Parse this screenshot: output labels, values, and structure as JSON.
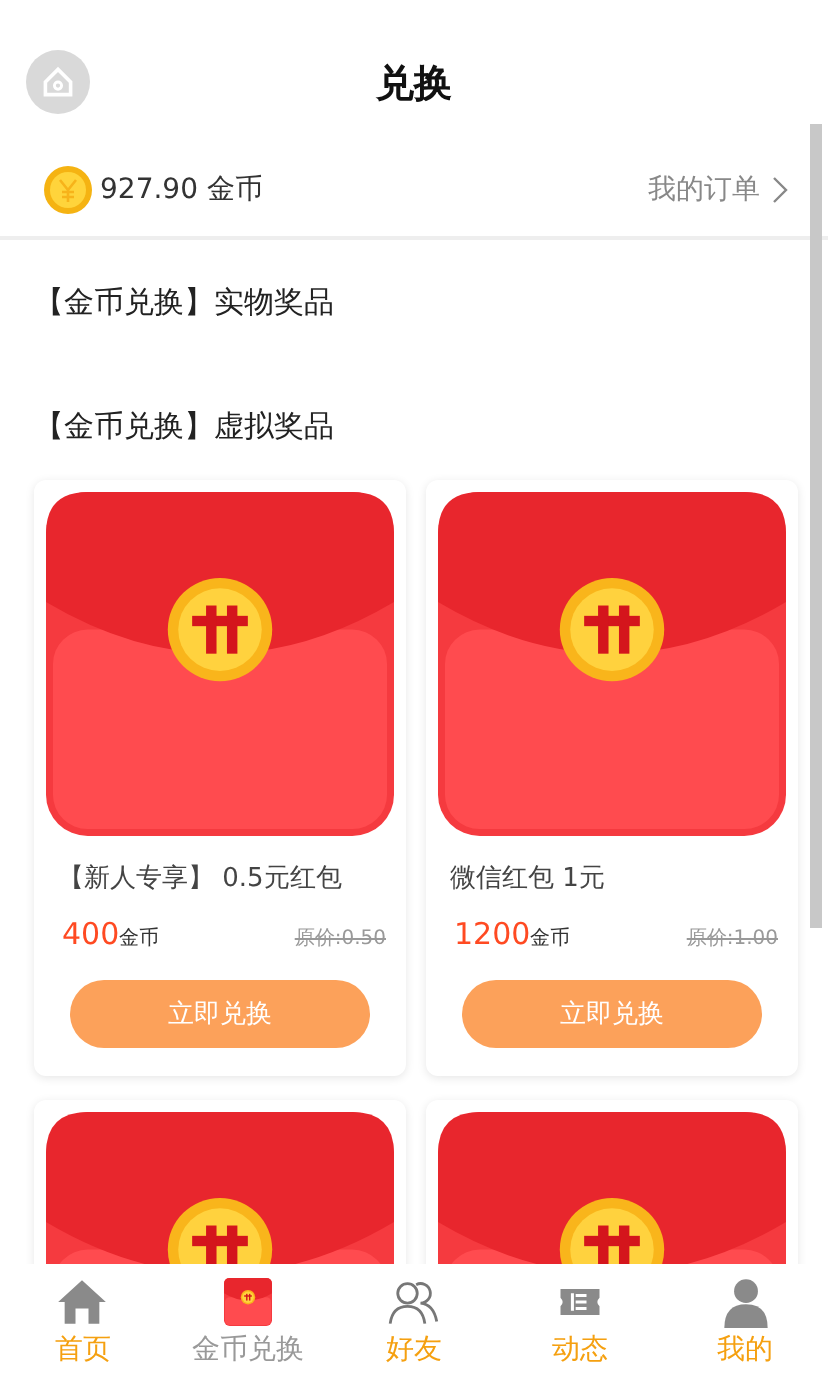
{
  "header": {
    "title": "兑换"
  },
  "balance": {
    "amount": "927.90",
    "unit": "金币",
    "orders_link": "我的订单"
  },
  "sections": [
    {
      "title": "【金币兑换】实物奖品"
    },
    {
      "title": "【金币兑换】虚拟奖品"
    }
  ],
  "products": [
    {
      "kind": "product",
      "name": "【新人专享】 0.5元红包",
      "price": "400",
      "unit": "金币",
      "original": "原价:0.50",
      "button": "立即兑换"
    },
    {
      "kind": "product",
      "name": "微信红包 1元",
      "price": "1200",
      "unit": "金币",
      "original": "原价:1.00",
      "button": "立即兑换"
    },
    {
      "kind": "picture"
    },
    {
      "kind": "picture"
    }
  ],
  "tab_bar": [
    {
      "label": "首页",
      "selected": false
    },
    {
      "label": "金币兑换",
      "selected": true
    },
    {
      "label": "好友",
      "selected": false
    },
    {
      "label": "动态",
      "selected": false
    },
    {
      "label": "我的",
      "selected": false
    }
  ]
}
